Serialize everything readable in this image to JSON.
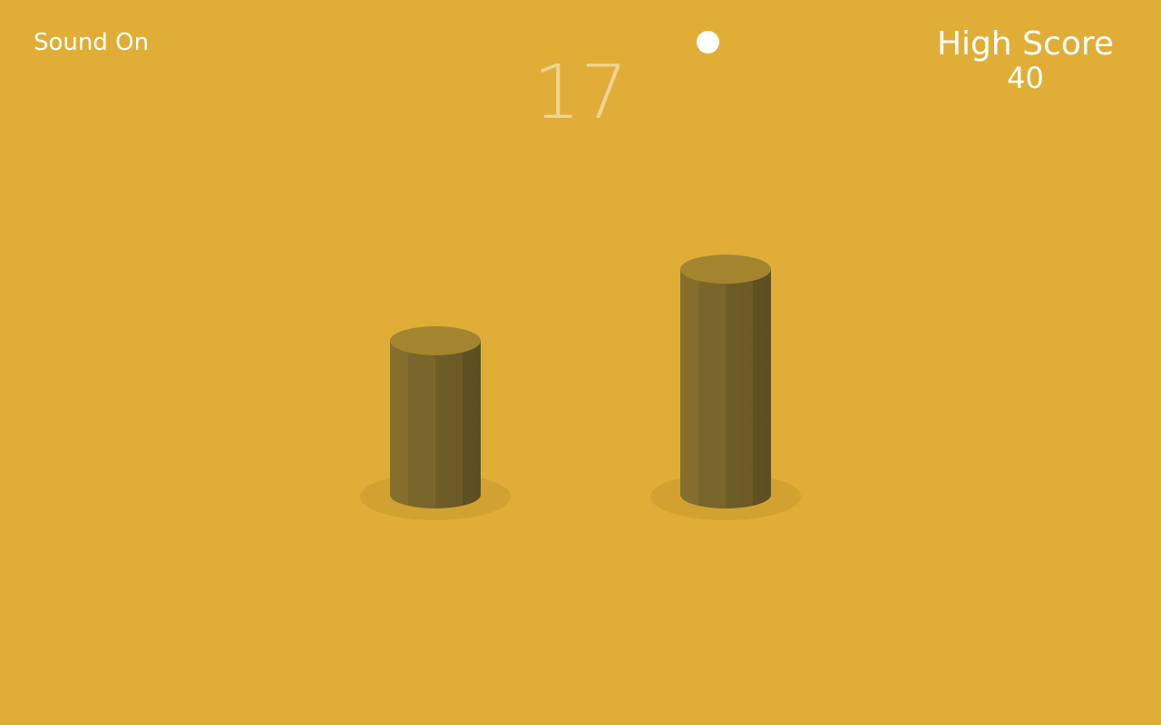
{
  "hud": {
    "sound_label": "Sound On",
    "score": "17",
    "high_score_label": "High Score",
    "high_score_value": "40"
  },
  "colors": {
    "background": "#E0AE37",
    "pillar_top": "#A4852F",
    "pillar_body": "#7F6A2C",
    "pillar_shadow": "#D1A231",
    "ball": "#FFFFFF",
    "score_text": "#F1D395"
  },
  "scene": {
    "ball_icon": "ball-icon",
    "pillars": [
      {
        "name": "pillar-left"
      },
      {
        "name": "pillar-right"
      }
    ]
  }
}
